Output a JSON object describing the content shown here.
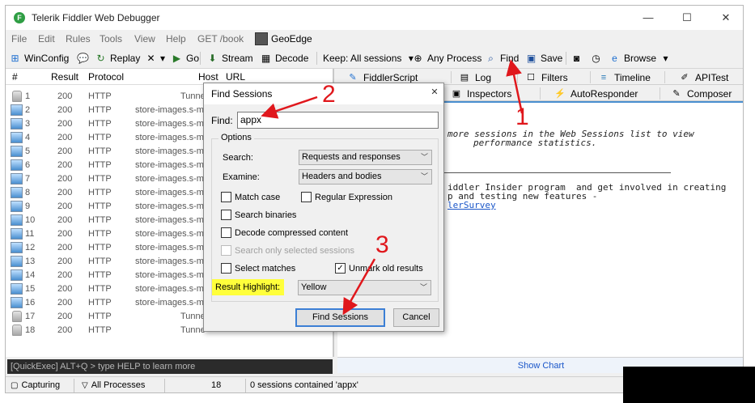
{
  "window": {
    "title": "Telerik Fiddler Web Debugger",
    "minimize": "—",
    "maximize": "☐",
    "close": "✕"
  },
  "menu": [
    "File",
    "Edit",
    "Rules",
    "Tools",
    "View",
    "Help",
    "GET /book",
    "GeoEdge"
  ],
  "toolbar": {
    "winconfig": "WinConfig",
    "replay": "Replay",
    "remove_arrow": "▾",
    "go": "Go",
    "stream": "Stream",
    "decode": "Decode",
    "keep": "Keep: All sessions",
    "any_process": "Any Process",
    "find": "Find",
    "save": "Save",
    "browse": "Browse"
  },
  "sessions": {
    "columns": [
      "#",
      "Result",
      "Protocol",
      "Host",
      "URL"
    ],
    "rows": [
      {
        "id": "1",
        "result": "200",
        "protocol": "HTTP",
        "host": "Tunne",
        "icon": "lock"
      },
      {
        "id": "2",
        "result": "200",
        "protocol": "HTTP",
        "host": "store-images.s-mi",
        "icon": "image"
      },
      {
        "id": "3",
        "result": "200",
        "protocol": "HTTP",
        "host": "store-images.s-mi",
        "icon": "image"
      },
      {
        "id": "4",
        "result": "200",
        "protocol": "HTTP",
        "host": "store-images.s-mi",
        "icon": "image"
      },
      {
        "id": "5",
        "result": "200",
        "protocol": "HTTP",
        "host": "store-images.s-mi",
        "icon": "image"
      },
      {
        "id": "6",
        "result": "200",
        "protocol": "HTTP",
        "host": "store-images.s-mi",
        "icon": "image"
      },
      {
        "id": "7",
        "result": "200",
        "protocol": "HTTP",
        "host": "store-images.s-mi",
        "icon": "image"
      },
      {
        "id": "8",
        "result": "200",
        "protocol": "HTTP",
        "host": "store-images.s-mi",
        "icon": "image"
      },
      {
        "id": "9",
        "result": "200",
        "protocol": "HTTP",
        "host": "store-images.s-mi",
        "icon": "image"
      },
      {
        "id": "10",
        "result": "200",
        "protocol": "HTTP",
        "host": "store-images.s-mi",
        "icon": "image"
      },
      {
        "id": "11",
        "result": "200",
        "protocol": "HTTP",
        "host": "store-images.s-mi",
        "icon": "image"
      },
      {
        "id": "12",
        "result": "200",
        "protocol": "HTTP",
        "host": "store-images.s-mi",
        "icon": "image"
      },
      {
        "id": "13",
        "result": "200",
        "protocol": "HTTP",
        "host": "store-images.s-mi",
        "icon": "image"
      },
      {
        "id": "14",
        "result": "200",
        "protocol": "HTTP",
        "host": "store-images.s-mi",
        "icon": "image"
      },
      {
        "id": "15",
        "result": "200",
        "protocol": "HTTP",
        "host": "store-images.s-mi",
        "icon": "image"
      },
      {
        "id": "16",
        "result": "200",
        "protocol": "HTTP",
        "host": "store-images.s-mi",
        "icon": "image"
      },
      {
        "id": "17",
        "result": "200",
        "protocol": "HTTP",
        "host": "Tunne",
        "icon": "lock"
      },
      {
        "id": "18",
        "result": "200",
        "protocol": "HTTP",
        "host": "Tunne",
        "icon": "lock"
      }
    ]
  },
  "quickexec": "[QuickExec] ALT+Q > type HELP to learn more",
  "tabs_row1": [
    "FiddlerScript",
    "Log",
    "Filters",
    "Timeline",
    "APITest"
  ],
  "tabs_row2": [
    "Inspectors",
    "AutoResponder",
    "Composer"
  ],
  "content": {
    "line1": "more sessions in the Web Sessions list to view",
    "line2": "performance statistics.",
    "line3": "iddler Insider program  and get involved in creating",
    "line4": "p and testing new features -",
    "link": "lerSurvey"
  },
  "show_chart": "Show Chart",
  "status": {
    "capturing": "Capturing",
    "processes": "All Processes",
    "count": "18",
    "message": "0 sessions contained 'appx'"
  },
  "dialog": {
    "title": "Find Sessions",
    "close": "✕",
    "find_label": "Find:",
    "find_value": "appx",
    "options_label": "Options",
    "search_label": "Search:",
    "search_value": "Requests and responses",
    "examine_label": "Examine:",
    "examine_value": "Headers and bodies",
    "match_case": "Match case",
    "regex": "Regular Expression",
    "search_binaries": "Search binaries",
    "decode_compressed": "Decode compressed content",
    "search_selected": "Search only selected sessions",
    "select_matches": "Select matches",
    "unmark_old": "Unmark old results",
    "unmark_checked": true,
    "highlight_label": "Result Highlight:",
    "highlight_value": "Yellow",
    "find_button": "Find Sessions",
    "cancel_button": "Cancel"
  },
  "annotations": {
    "step1": "1",
    "step2": "2",
    "step3": "3",
    "color": "#e0171c"
  },
  "colors": {
    "accent": "#3c7fd5",
    "highlight": "#ffff3b",
    "link": "#1a56c9"
  }
}
